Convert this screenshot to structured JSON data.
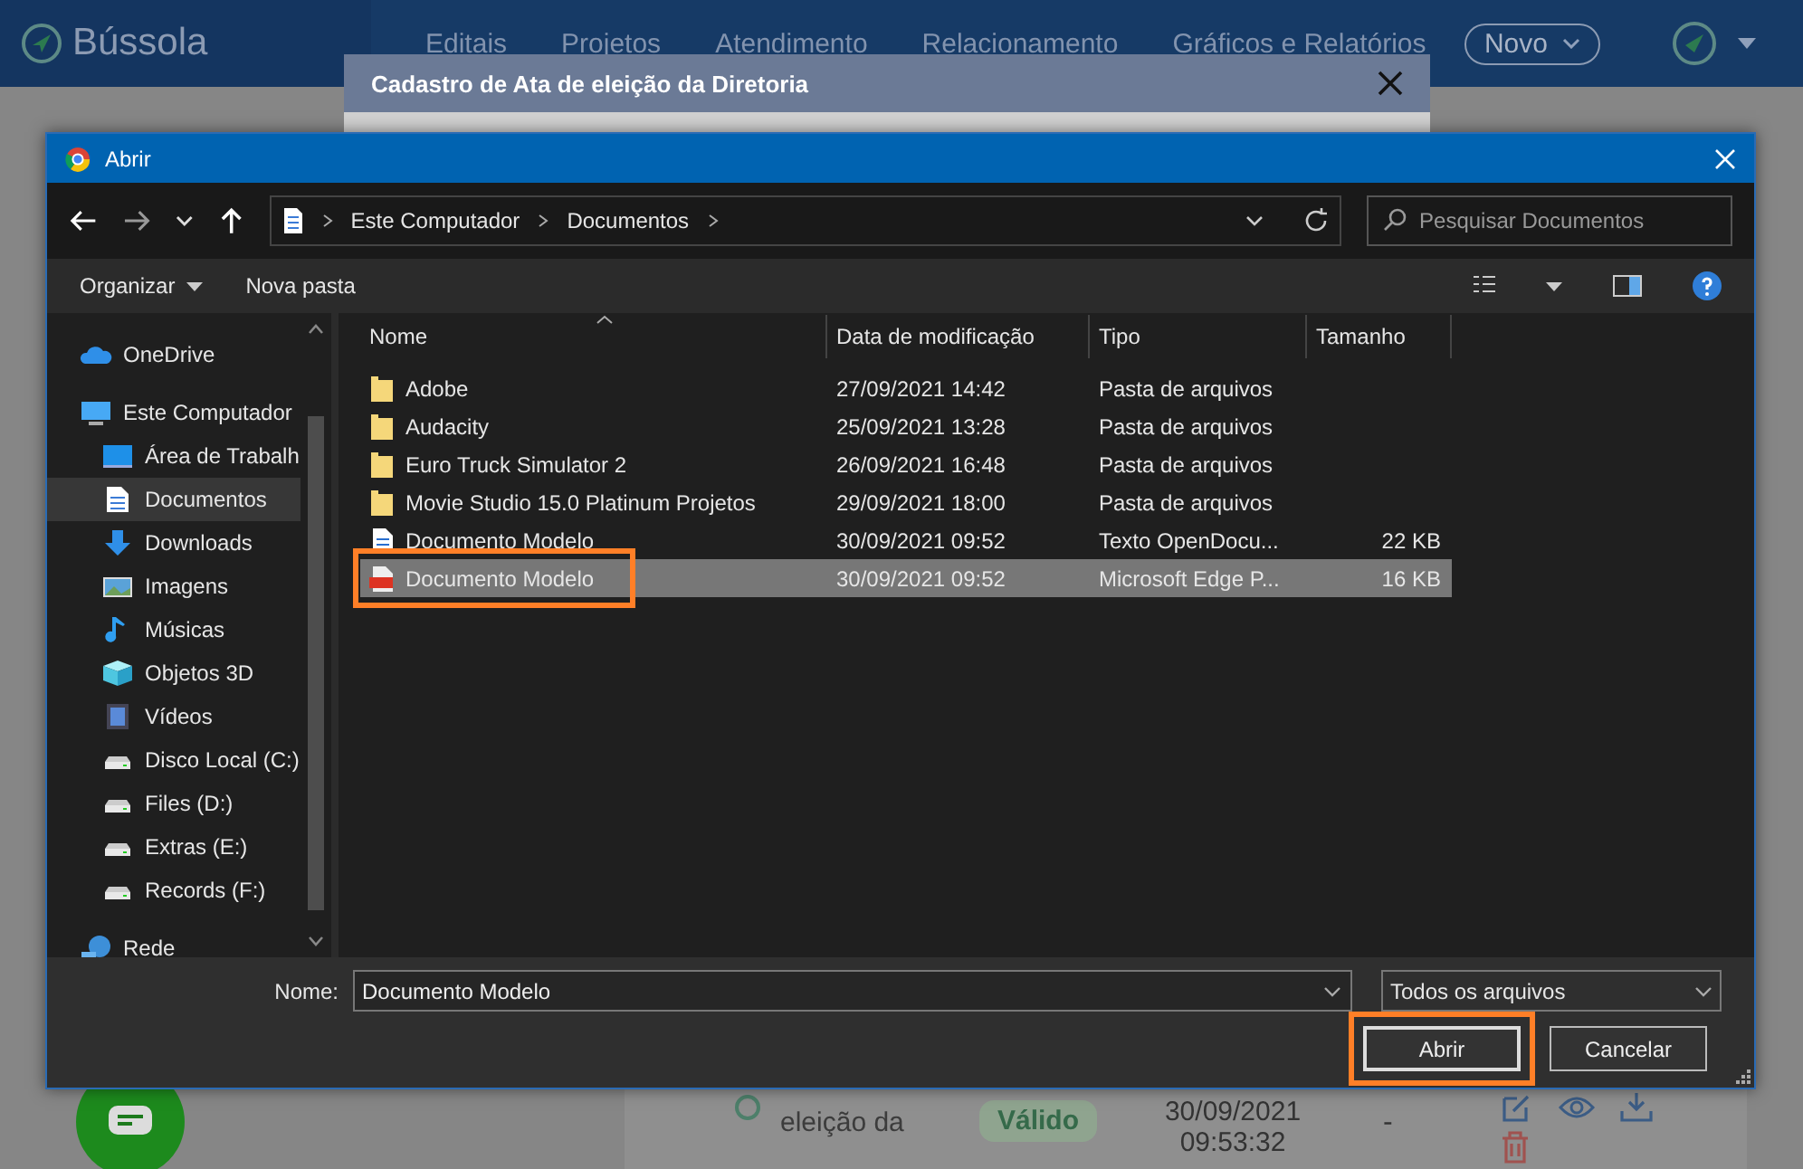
{
  "app": {
    "logo": "Bússola",
    "nav": [
      "Editais",
      "Projetos",
      "Atendimento",
      "Relacionamento",
      "Gráficos e Relatórios"
    ],
    "new_button": "Novo"
  },
  "background_row": {
    "title": "eleição da",
    "status": "Válido",
    "date": "30/09/2021 09:53:32",
    "size": "-"
  },
  "modal": {
    "title": "Cadastro de Ata de eleição da Diretoria"
  },
  "dialog": {
    "title": "Abrir",
    "path": [
      "Este Computador",
      "Documentos"
    ],
    "search_placeholder": "Pesquisar Documentos",
    "toolbar": [
      "Organizar",
      "Nova pasta"
    ],
    "sidebar": [
      {
        "label": "OneDrive",
        "kind": "cloud",
        "selected": false
      },
      {
        "label": "Este Computador",
        "kind": "computer",
        "selected": false,
        "children": [
          {
            "label": "Área de Trabalh",
            "kind": "desktop",
            "selected": false
          },
          {
            "label": "Documentos",
            "kind": "document",
            "selected": true
          },
          {
            "label": "Downloads",
            "kind": "download",
            "selected": false
          },
          {
            "label": "Imagens",
            "kind": "image",
            "selected": false
          },
          {
            "label": "Músicas",
            "kind": "music",
            "selected": false
          },
          {
            "label": "Objetos 3D",
            "kind": "cube",
            "selected": false
          },
          {
            "label": "Vídeos",
            "kind": "video",
            "selected": false
          },
          {
            "label": "Disco Local (C:)",
            "kind": "drive",
            "selected": false
          },
          {
            "label": "Files (D:)",
            "kind": "drive",
            "selected": false
          },
          {
            "label": "Extras (E:)",
            "kind": "drive",
            "selected": false
          },
          {
            "label": "Records (F:)",
            "kind": "drive",
            "selected": false
          }
        ]
      },
      {
        "label": "Rede",
        "kind": "network",
        "selected": false
      }
    ],
    "columns": [
      "Nome",
      "Data de modificação",
      "Tipo",
      "Tamanho"
    ],
    "files": [
      {
        "name": "Adobe",
        "kind": "folder",
        "modified": "27/09/2021 14:42",
        "type": "Pasta de arquivos",
        "selected": false
      },
      {
        "name": "Audacity",
        "kind": "folder",
        "modified": "25/09/2021 13:28",
        "type": "Pasta de arquivos",
        "selected": false
      },
      {
        "name": "Euro Truck Simulator 2",
        "kind": "folder",
        "modified": "26/09/2021 16:48",
        "type": "Pasta de arquivos",
        "selected": false
      },
      {
        "name": "Movie Studio 15.0 Platinum Projetos",
        "kind": "folder",
        "modified": "29/09/2021 18:00",
        "type": "Pasta de arquivos",
        "selected": false
      },
      {
        "name": "Documento Modelo",
        "kind": "document",
        "modified": "30/09/2021 09:52",
        "type": "Texto OpenDocu...",
        "size": "22 KB",
        "selected": false
      },
      {
        "name": "Documento Modelo",
        "kind": "pdf",
        "modified": "30/09/2021 09:52",
        "type": "Microsoft Edge P...",
        "size": "16 KB",
        "selected": true
      }
    ],
    "filename_label": "Nome:",
    "filename": "Documento Modelo",
    "filter": "Todos os arquivos",
    "buttons": [
      {
        "label": "Abrir",
        "kind": "primary"
      },
      {
        "label": "Cancelar",
        "kind": "secondary"
      }
    ]
  }
}
